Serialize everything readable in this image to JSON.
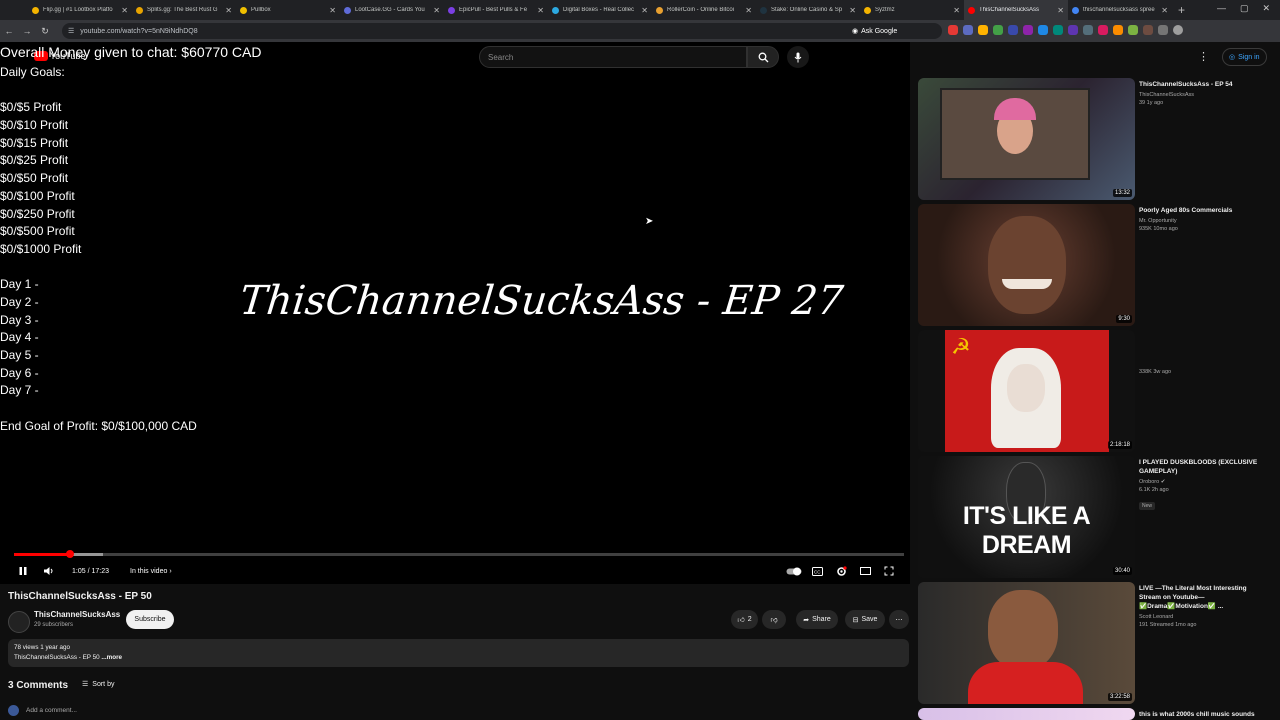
{
  "browser": {
    "tabs": [
      {
        "title": "Flip.gg | #1 Lootbox Platfo",
        "color": "#f4b400"
      },
      {
        "title": "Splits.gg: The Best Rust G",
        "color": "#e8a400"
      },
      {
        "title": "Pullbox",
        "color": "#f0c000"
      },
      {
        "title": "LootCase.GG - Cards You",
        "color": "#5f6bd8"
      },
      {
        "title": "EpicPull - Best Pulls & Fe",
        "color": "#7b3fe4"
      },
      {
        "title": "Digital Boxes - Real Collec",
        "color": "#2ca9e1"
      },
      {
        "title": "RollerCoin - Online Bitcoi",
        "color": "#e8a030"
      },
      {
        "title": "Stake: Online Casino & Sp",
        "color": "#1f3340"
      },
      {
        "title": "Syztmz",
        "color": "#f4b400"
      },
      {
        "title": "ThisChannelSucksAss",
        "color": "#ff0000"
      },
      {
        "title": "thischannelsucksass spree",
        "color": "#4285f4"
      }
    ],
    "url": "youtube.com/watch?v=5nN9iNdhDQ8",
    "ask_google": "Ask Google"
  },
  "header": {
    "logo_text": "YouTube",
    "search_placeholder": "Search",
    "sign_in": "Sign in"
  },
  "player": {
    "overlay_top": "Overall Money given to chat: $60770 CAD",
    "goals": [
      "Daily Goals:",
      "",
      "$0/$5 Profit",
      "$0/$10 Profit",
      "$0/$15 Profit",
      "$0/$25 Profit",
      "$0/$50 Profit",
      "$0/$100 Profit",
      "$0/$250 Profit",
      "$0/$500 Profit",
      "$0/$1000 Profit",
      "",
      "Day 1 -",
      "Day 2 -",
      "Day 3 -",
      "Day 4 -",
      "Day 5 -",
      "Day 6 -",
      "Day 7 -",
      "",
      "End Goal of Profit: $0/$100,000 CAD"
    ],
    "center_title": "ThisChannelSucksAss - EP 27",
    "time": "1:05 / 17:23",
    "in_this_video": "In this video",
    "progress_fraction": 0.063,
    "buffered_fraction": 0.1
  },
  "video": {
    "title": "ThisChannelSucksAss - EP 50",
    "channel": "ThisChannelSucksAss",
    "subscribers": "29 subscribers",
    "subscribe_label": "Subscribe",
    "likes": "2",
    "share_label": "Share",
    "save_label": "Save",
    "desc_stats": "78 views  1 year ago",
    "desc_text": "ThisChannelSucksAss - EP 50",
    "desc_more": "...more"
  },
  "comments": {
    "count_label": "3 Comments",
    "sort_label": "Sort by",
    "add_placeholder": "Add a comment..."
  },
  "related": [
    {
      "title": "ThisChannelSucksAss - EP 54",
      "channel": "ThisChannelSucksAss",
      "stats": "39  1y ago",
      "duration": "13:32",
      "badge": ""
    },
    {
      "title": "Poorly Aged 80s Commercials",
      "channel": "Mr. Opportunity",
      "stats": "935K  10mo ago",
      "duration": "9:30",
      "badge": ""
    },
    {
      "title": "",
      "channel": "",
      "stats": "338K  3w ago",
      "duration": "2:18:18",
      "badge": ""
    },
    {
      "title": "I PLAYED DUSKBLOODS (EXCLUSIVE GAMEPLAY)",
      "channel": "Oroboro",
      "stats": "6.1K  2h ago",
      "duration": "30:40",
      "badge": "New"
    },
    {
      "title": "LIVE —The Literal Most Interesting Stream on Youtube— ✅Drama✅Motivation✅ ...",
      "channel": "Scott Leonard",
      "stats": "191  Streamed 1mo ago",
      "duration": "3:22:58",
      "badge": ""
    },
    {
      "title": "this is what 2000s chill music sounds",
      "channel": "",
      "stats": "",
      "duration": "",
      "badge": ""
    }
  ],
  "thumb_text": {
    "dream": "IT'S LIKE A DREAM"
  },
  "colors": {
    "accent": "#ff0000",
    "link": "#3ea6ff",
    "background": "#0f0f0f"
  }
}
